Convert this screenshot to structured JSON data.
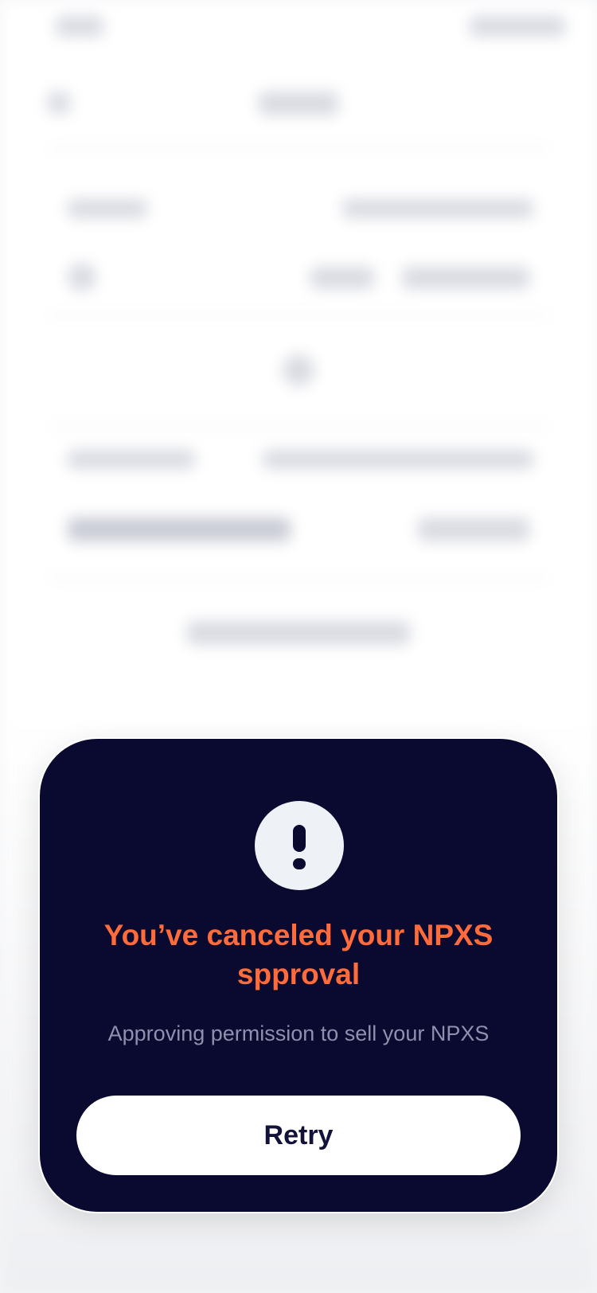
{
  "modal": {
    "icon": "exclamation-icon",
    "title": "You’ve canceled your NPXS spproval",
    "subtitle": "Approving permission to sell your NPXS",
    "retry_label": "Retry"
  },
  "colors": {
    "modal_background": "#0a0a30",
    "title_accent": "#ff6b3a",
    "subtitle": "#8f90ad",
    "button_background": "#ffffff",
    "button_text": "#12123a"
  }
}
